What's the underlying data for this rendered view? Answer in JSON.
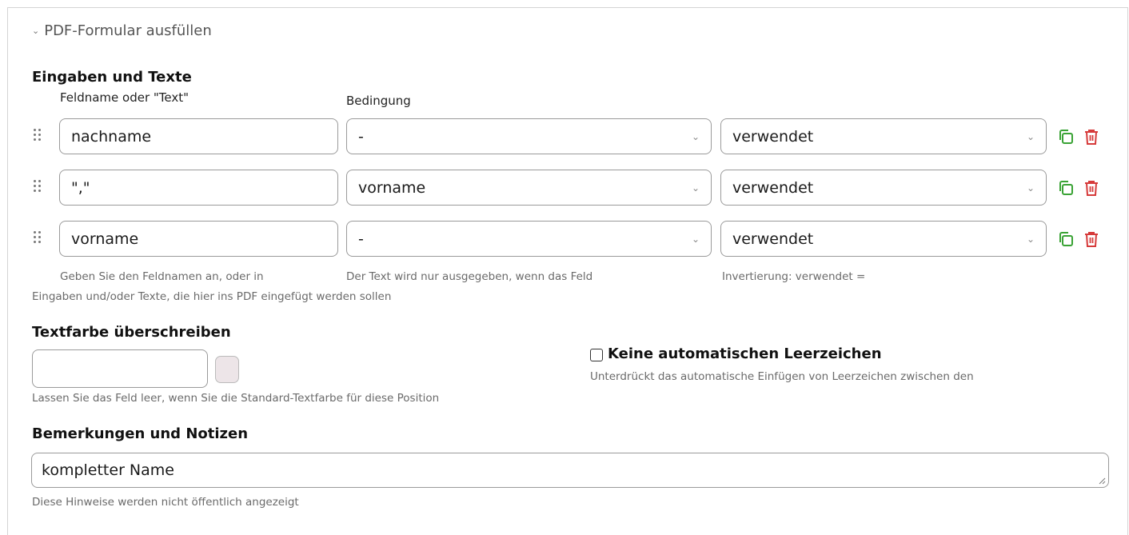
{
  "section": {
    "title": "PDF-Formular ausfüllen",
    "chevron_icon": "chevron-down-icon"
  },
  "inputs_section": {
    "heading": "Eingaben und Texte",
    "col_fieldname": "Feldname oder \"Text\"",
    "col_condition": "Bedingung",
    "rows": [
      {
        "field": "nachname",
        "condition": "-",
        "mode": "verwendet"
      },
      {
        "field": "\",\"",
        "condition": "vorname",
        "mode": "verwendet"
      },
      {
        "field": "vorname",
        "condition": "-",
        "mode": "verwendet"
      }
    ],
    "help_fieldname": "Geben Sie den Feldnamen an, oder in",
    "help_condition": "Der Text wird nur ausgegeben, wenn das Feld",
    "help_mode": "Invertierung: verwendet =",
    "help_section": "Eingaben und/oder Texte, die hier ins PDF eingefügt werden sollen",
    "icons": {
      "copy": "copy-icon",
      "delete": "trash-icon",
      "drag": "drag-handle-icon",
      "copy_color": "#3aa335",
      "delete_color": "#d63a3a"
    }
  },
  "text_color": {
    "heading": "Textfarbe überschreiben",
    "value": "",
    "swatch_color": "#ede5e8",
    "help": "Lassen Sie das Feld leer, wenn Sie die Standard-Textfarbe für diese Position"
  },
  "no_spaces": {
    "label": "Keine automatischen Leerzeichen",
    "checked": false,
    "help": "Unterdrückt das automatische Einfügen von Leerzeichen zwischen den"
  },
  "notes": {
    "heading": "Bemerkungen und Notizen",
    "value": "kompletter Name",
    "help": "Diese Hinweise werden nicht öffentlich angezeigt"
  }
}
